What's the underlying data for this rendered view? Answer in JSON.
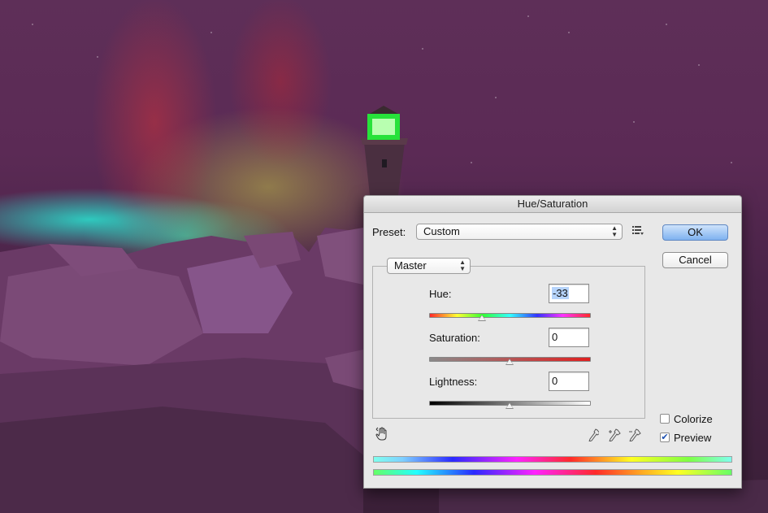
{
  "dialog": {
    "title": "Hue/Saturation",
    "preset_label": "Preset:",
    "preset_value": "Custom",
    "channel_value": "Master",
    "ok_label": "OK",
    "cancel_label": "Cancel",
    "hue_label": "Hue:",
    "hue_value": "-33",
    "hue_level": 0.33,
    "saturation_label": "Saturation:",
    "saturation_value": "0",
    "saturation_level": 0.5,
    "lightness_label": "Lightness:",
    "lightness_value": "0",
    "lightness_level": 0.5,
    "colorize_label": "Colorize",
    "colorize_checked": false,
    "preview_label": "Preview",
    "preview_checked": true
  },
  "icons": {
    "preset_options": "list-menu-icon",
    "targeted_adjust": "hand-adjust-icon",
    "eyedropper": "eyedropper-icon",
    "eyedropper_add": "eyedropper-plus-icon",
    "eyedropper_subtract": "eyedropper-minus-icon"
  },
  "colors": {
    "default_button": "#7fb2f0",
    "text_selection": "#b5d3fb"
  }
}
